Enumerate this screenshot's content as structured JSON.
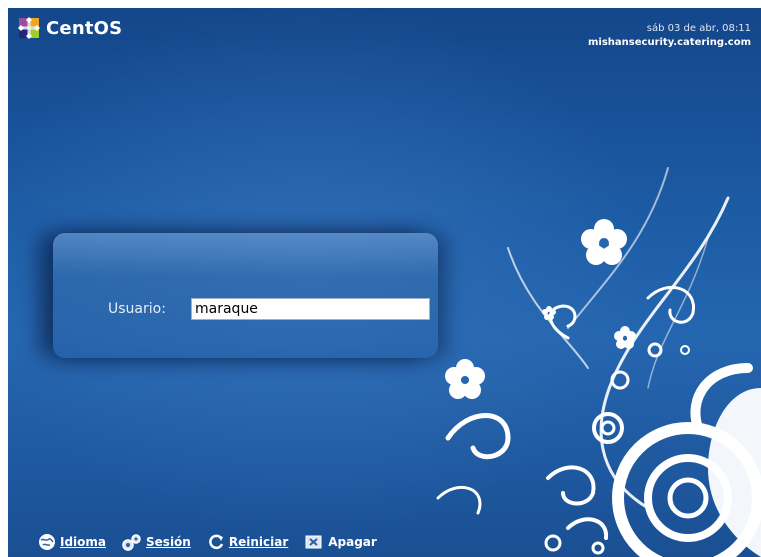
{
  "brand": {
    "name": "CentOS"
  },
  "clock": {
    "datetime": "sáb 03 de abr, 08:11",
    "hostname": "mishansecurity.catering.com"
  },
  "login": {
    "label": "Usuario:",
    "value": "maraque"
  },
  "actions": [
    {
      "label": "Idioma",
      "icon": "language-icon"
    },
    {
      "label": "Sesión",
      "icon": "session-icon"
    },
    {
      "label": "Reiniciar",
      "icon": "restart-icon"
    },
    {
      "label": "Apagar",
      "icon": "shutdown-icon"
    }
  ],
  "colors": {
    "background": "#1d5da6",
    "text": "#ffffff"
  }
}
